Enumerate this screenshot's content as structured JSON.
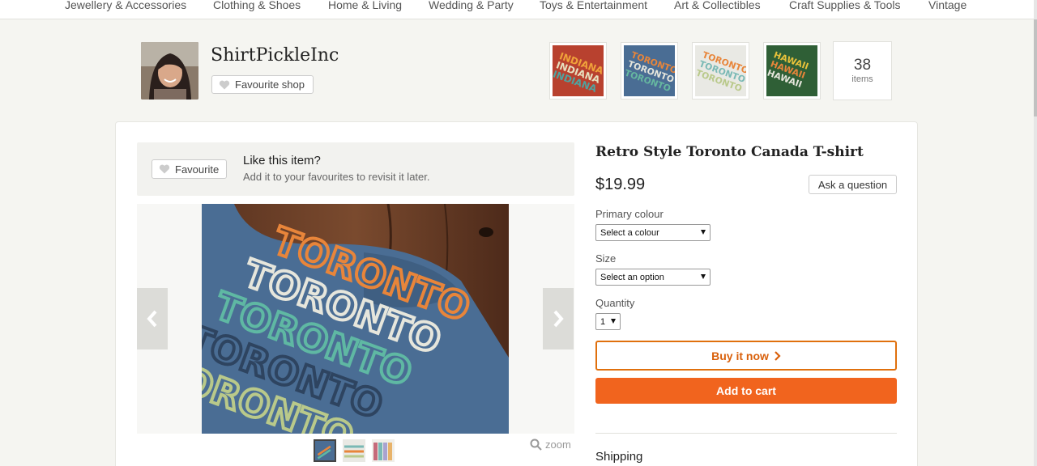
{
  "nav": {
    "items": [
      "Jewellery & Accessories",
      "Clothing & Shoes",
      "Home & Living",
      "Wedding & Party",
      "Toys & Entertainment",
      "Art & Collectibles",
      "Craft Supplies & Tools",
      "Vintage"
    ]
  },
  "shop": {
    "name": "ShirtPickleInc",
    "favourite_label": "Favourite shop",
    "items_count": "38",
    "items_label": "items"
  },
  "like": {
    "button_label": "Favourite",
    "title": "Like this item?",
    "subtitle": "Add it to your favourites to revisit it later."
  },
  "gallery": {
    "zoom_label": "zoom",
    "main_image_text": "TORONTO"
  },
  "listing": {
    "title": "Retro Style Toronto Canada T-shirt",
    "price": "$19.99",
    "ask_label": "Ask a question",
    "primary_colour_label": "Primary colour",
    "primary_colour_value": "Select a colour",
    "size_label": "Size",
    "size_value": "Select an option",
    "quantity_label": "Quantity",
    "quantity_value": "1",
    "buy_now_label": "Buy it now",
    "add_to_cart_label": "Add to cart",
    "shipping_label": "Shipping"
  },
  "colors": {
    "accent": "#f1641e",
    "buy_border": "#e0700d",
    "shirt_blue": "#4a6d94",
    "wood": "#6b3f26"
  }
}
